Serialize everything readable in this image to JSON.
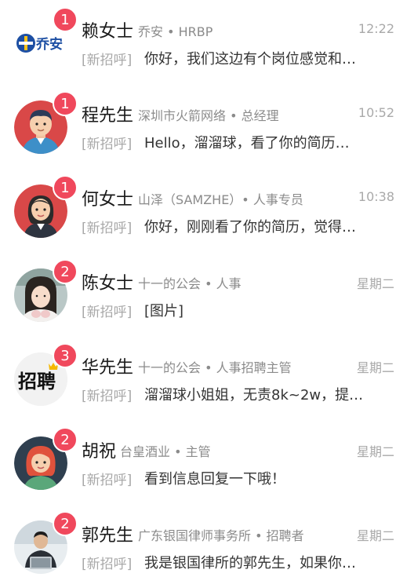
{
  "conversations": [
    {
      "badge": "1",
      "name": "赖女士",
      "company": "乔安 • HRBP",
      "time": "12:22",
      "tag": "[新招呼]",
      "message": "你好，我们这边有个岗位感觉和…",
      "logo_text": "乔安",
      "avatar": "logo-qiaoan"
    },
    {
      "badge": "1",
      "name": "程先生",
      "company": "深圳市火箭网络 • 总经理",
      "time": "10:52",
      "tag": "[新招呼]",
      "message": "Hello，溜溜球，看了你的简历…",
      "avatar": "man-cartoon"
    },
    {
      "badge": "1",
      "name": "何女士",
      "company": "山泽（SAMZHE）• 人事专员",
      "time": "10:38",
      "tag": "[新招呼]",
      "message": "你好，刚刚看了你的简历，觉得…",
      "avatar": "woman-cartoon"
    },
    {
      "badge": "2",
      "name": "陈女士",
      "company": "十一的公会 • 人事",
      "time": "星期二",
      "tag": "[新招呼]",
      "message": "[图片]",
      "avatar": "photo-girl"
    },
    {
      "badge": "3",
      "name": "华先生",
      "company": "十一的公会 • 人事招聘主管",
      "time": "星期二",
      "tag": "[新招呼]",
      "message": "溜溜球小姐姐，无责8k~2w，提…",
      "logo_text": "招聘",
      "avatar": "logo-zhaopin"
    },
    {
      "badge": "2",
      "name": "胡祝",
      "company": "台皇酒业 • 主管",
      "time": "星期二",
      "tag": "[新招呼]",
      "message": "看到信息回复一下哦！",
      "avatar": "woman-red-hair"
    },
    {
      "badge": "2",
      "name": "郭先生",
      "company": "广东银国律师事务所 • 招聘者",
      "time": "星期二",
      "tag": "[新招呼]",
      "message": "我是银国律所的郭先生，如果你…",
      "avatar": "photo-man-laptop"
    }
  ],
  "colors": {
    "badge": "#f0485c",
    "name": "#1a1a1a",
    "company": "#8b8b8b",
    "tag": "#a8a8a8",
    "message": "#333333",
    "time": "#a9a9a9"
  }
}
